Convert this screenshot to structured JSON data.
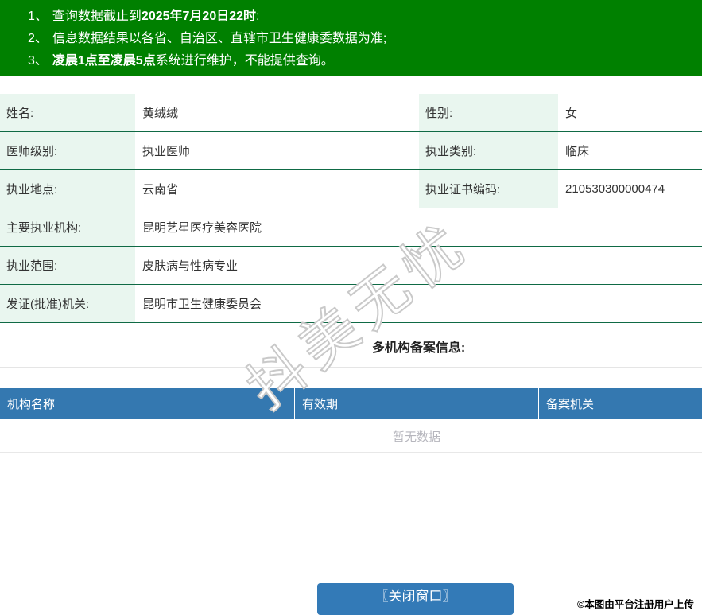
{
  "banner": {
    "bg_color": "#008000",
    "notices": [
      {
        "num": "1、",
        "pre": "查询数据截止到",
        "bold": "2025年7月20日22时",
        "post": ";"
      },
      {
        "num": "2、",
        "pre": "信息数据结果以各省、自治区、直辖市卫生健康委数据为准;",
        "bold": "",
        "post": ""
      },
      {
        "num": "3、",
        "pre": "",
        "bold": "凌晨1点至凌晨5点",
        "post": "系统进行维护，不能提供查询。"
      }
    ]
  },
  "info": {
    "label_bg": "#e9f6ef",
    "divider_color": "#0f6a45",
    "row1": {
      "label1": "姓名:",
      "value1": "黄绒绒",
      "label2": "性别:",
      "value2": "女"
    },
    "row2": {
      "label1": "医师级别:",
      "value1": "执业医师",
      "label2": "执业类别:",
      "value2": "临床"
    },
    "row3": {
      "label1": "执业地点:",
      "value1": "云南省",
      "label2": "执业证书编码:",
      "value2": "210530300000474"
    },
    "row4": {
      "label": "主要执业机构:",
      "value": "昆明艺星医疗美容医院"
    },
    "row5": {
      "label": "执业范围:",
      "value": "皮肤病与性病专业"
    },
    "row6": {
      "label": "发证(批准)机关:",
      "value": "昆明市卫生健康委员会"
    }
  },
  "records": {
    "section_title": "多机构备案信息:",
    "header_bg": "#3478b0",
    "columns": [
      "机构名称",
      "有效期",
      "备案机关"
    ],
    "empty_text": "暂无数据"
  },
  "watermark_text": "抖美无忧",
  "footer": {
    "close_button_label": "〖关闭窗口〗",
    "button_color": "#337ab7",
    "copyright_text": "©本图由平台注册用户上传"
  }
}
